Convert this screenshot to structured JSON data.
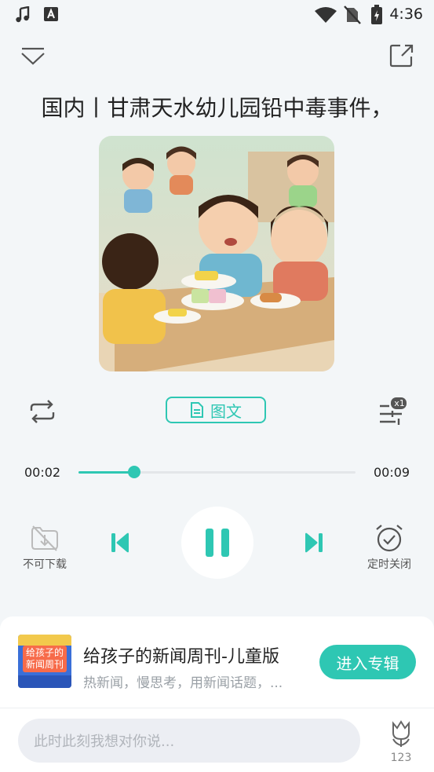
{
  "status_bar": {
    "time": "4:36"
  },
  "episode": {
    "title": "国内丨甘肃天水幼儿园铅中毒事件，",
    "tuwen_label": "图文",
    "speed_badge": "x1"
  },
  "progress": {
    "current_time": "00:02",
    "total_time": "00:09",
    "fraction": 0.2
  },
  "controls": {
    "download_label": "不可下载",
    "timer_label": "定时关闭"
  },
  "album": {
    "title": "给孩子的新闻周刊-儿童版",
    "description": "热新闻，慢思考，用新闻话题，...",
    "enter_label": "进入专辑",
    "cover_text": "给孩子的新闻周刊"
  },
  "comment": {
    "placeholder": "此时此刻我想对你说...",
    "flower_count": "123"
  },
  "colors": {
    "accent": "#2ec7b3",
    "background": "#f3f6f8"
  }
}
